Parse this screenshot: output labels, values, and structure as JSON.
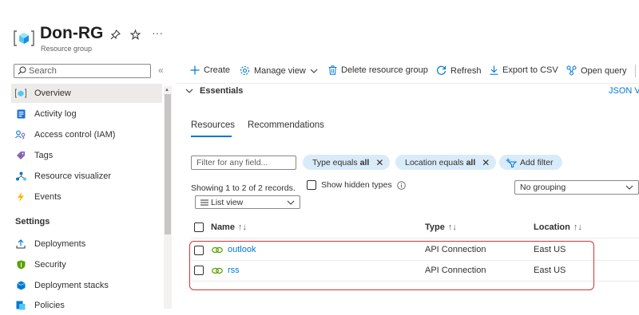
{
  "header": {
    "title": "Don-RG",
    "subtitle": "Resource group",
    "pin_icon": "pin-icon",
    "star_icon": "star-icon",
    "more_label": "···"
  },
  "sidebar": {
    "search_placeholder": "Search",
    "collapse_label": "«",
    "items": [
      {
        "label": "Overview",
        "icon": "resource-group-icon",
        "active": true
      },
      {
        "label": "Activity log",
        "icon": "activity-log-icon"
      },
      {
        "label": "Access control (IAM)",
        "icon": "iam-icon"
      },
      {
        "label": "Tags",
        "icon": "tag-icon"
      },
      {
        "label": "Resource visualizer",
        "icon": "visualizer-icon"
      },
      {
        "label": "Events",
        "icon": "lightning-icon"
      }
    ],
    "settings_heading": "Settings",
    "settings_items": [
      {
        "label": "Deployments",
        "icon": "deployments-icon"
      },
      {
        "label": "Security",
        "icon": "shield-icon"
      },
      {
        "label": "Deployment stacks",
        "icon": "stack-icon"
      },
      {
        "label": "Policies",
        "icon": "policy-icon"
      }
    ]
  },
  "toolbar": {
    "create": "Create",
    "manage_view": "Manage view",
    "delete": "Delete resource group",
    "refresh": "Refresh",
    "export": "Export to CSV",
    "open_query": "Open query"
  },
  "essentials": {
    "label": "Essentials",
    "json_view": "JSON Vi"
  },
  "tabs": [
    "Resources",
    "Recommendations"
  ],
  "filters": {
    "placeholder": "Filter for any field...",
    "type_pill": {
      "label": "Type equals",
      "value": "all"
    },
    "location_pill": {
      "label": "Location equals",
      "value": "all"
    },
    "add_filter": "Add filter"
  },
  "records_text": "Showing 1 to 2 of 2 records.",
  "show_hidden": "Show hidden types",
  "list_view": "List view",
  "grouping": "No grouping",
  "table": {
    "columns": [
      "Name",
      "Type",
      "Location"
    ],
    "sort_glyph": "↑↓",
    "rows": [
      {
        "name": "outlook",
        "type": "API Connection",
        "location": "East US"
      },
      {
        "name": "rss",
        "type": "API Connection",
        "location": "East US"
      }
    ]
  },
  "colors": {
    "accent": "#0078d4",
    "highlight": "#d13438",
    "pill": "#d9ebf9"
  }
}
